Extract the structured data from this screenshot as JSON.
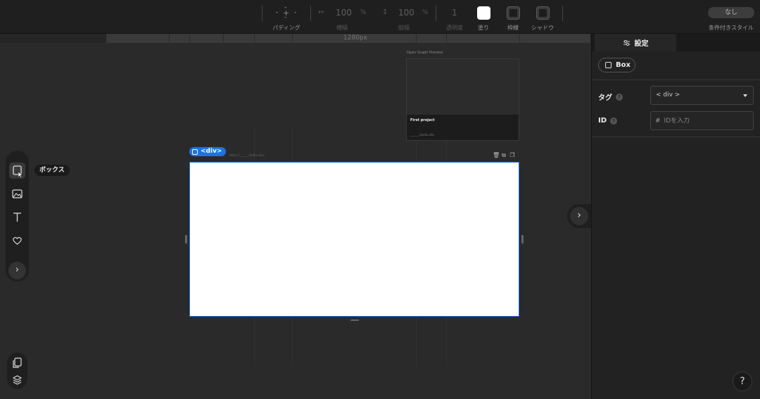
{
  "toolbar": {
    "padding_label": "パディング",
    "width_label": "横幅",
    "width_value": "100",
    "width_unit": "%",
    "height_label": "縦幅",
    "height_value": "100",
    "height_unit": "%",
    "opacity_label": "透明度",
    "opacity_value": "1",
    "fill_label": "塗り",
    "border_label": "枠線",
    "shadow_label": "シャドウ",
    "conditional_label": "条件付きスタイル",
    "conditional_value": "なし",
    "fill_color": "#ffffff"
  },
  "ruler": {
    "label": "1280px"
  },
  "canvas": {
    "og_preview_title": "Open Graph Preview",
    "og_project_name": "First project",
    "og_url": "______.studio.site",
    "selected_tag": "<div>",
    "breadcrumb": "https://______.studio.site/",
    "accent_color": "#1a73e8"
  },
  "left_tools": {
    "tooltip": "ボックス",
    "items": [
      "box-icon",
      "image-icon",
      "text-icon",
      "heart-icon",
      "chevron-right-icon"
    ]
  },
  "panel": {
    "tab_label": "設定",
    "element_type": "Box",
    "tag_label": "タグ",
    "tag_value": "< div >",
    "id_label": "ID",
    "id_placeholder": "IDを入力",
    "id_prefix": "#",
    "help_label": "?"
  }
}
